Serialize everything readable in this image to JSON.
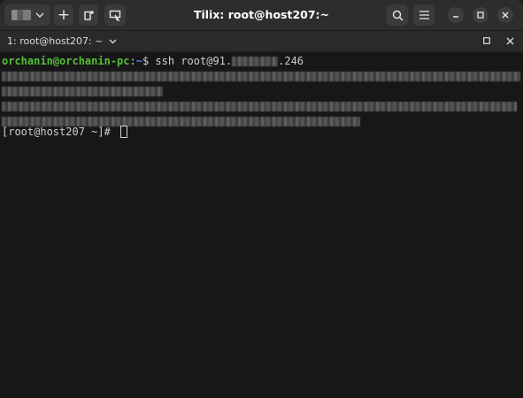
{
  "window": {
    "title": "Tilix: root@host207:~"
  },
  "headerbar": {
    "add_label": "+",
    "icons": {
      "session": "session-switcher-icon",
      "add": "add-session-icon",
      "new_window": "new-window-icon",
      "sync": "sync-input-icon",
      "search": "search-icon",
      "menu": "hamburger-menu-icon",
      "minimize": "minimize-icon",
      "maximize": "maximize-icon",
      "close": "close-icon"
    }
  },
  "terminal_tab": {
    "title": "1: root@host207: ~"
  },
  "terminal": {
    "prompt_user": "orchanin@orchanin-pc",
    "prompt_sep": ":",
    "prompt_path": "~",
    "prompt_symbol": "$ ",
    "command_prefix": "ssh root@91.",
    "command_suffix": ".246",
    "remote_prompt": "[root@host207 ~]# "
  },
  "colors": {
    "user": "#52c036",
    "path": "#4a8fe0",
    "text": "#d0d0d0",
    "background": "#171717"
  }
}
